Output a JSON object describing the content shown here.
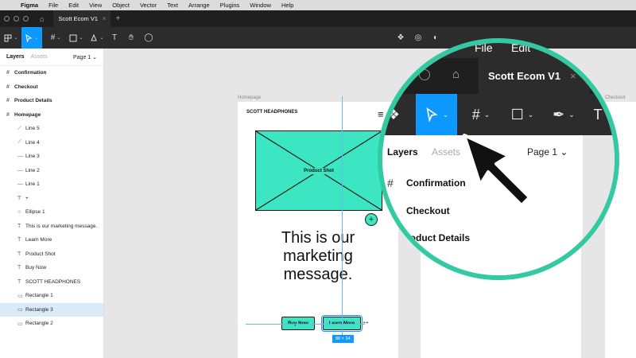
{
  "menubar": {
    "items": [
      "Figma",
      "File",
      "Edit",
      "View",
      "Object",
      "Vector",
      "Text",
      "Arrange",
      "Plugins",
      "Window",
      "Help"
    ]
  },
  "tabbar": {
    "file_tab": "Scott Ecom V1",
    "close_glyph": "×",
    "new_tab_glyph": "+"
  },
  "toolbar": {
    "tools": [
      "main-menu-icon",
      "move-tool-icon",
      "frame-tool-icon",
      "shape-tool-icon",
      "pen-tool-icon",
      "text-tool-icon",
      "hand-tool-icon",
      "comment-tool-icon"
    ],
    "active_tool": "move-tool-icon",
    "center_tools": [
      "component-icon",
      "mask-icon",
      "contrast-icon"
    ],
    "accent_color": "#0d99ff"
  },
  "left_panel": {
    "tab_layers": "Layers",
    "tab_assets": "Assets",
    "page_selector": "Page 1",
    "layers": [
      {
        "label": "Confirmation",
        "icon": "frame-icon",
        "type": "frame"
      },
      {
        "label": "Checkout",
        "icon": "frame-icon",
        "type": "frame"
      },
      {
        "label": "Product Details",
        "icon": "frame-icon",
        "type": "frame"
      },
      {
        "label": "Homepage",
        "icon": "frame-icon",
        "type": "frame"
      },
      {
        "label": "Line 5",
        "icon": "line-icon",
        "type": "child"
      },
      {
        "label": "Line 4",
        "icon": "line-icon",
        "type": "child"
      },
      {
        "label": "Line 3",
        "icon": "line-icon",
        "type": "child"
      },
      {
        "label": "Line 2",
        "icon": "line-icon",
        "type": "child"
      },
      {
        "label": "Line 1",
        "icon": "line-icon",
        "type": "child"
      },
      {
        "label": "+",
        "icon": "text-icon",
        "type": "child"
      },
      {
        "label": "Ellipse 1",
        "icon": "ellipse-icon",
        "type": "child"
      },
      {
        "label": "This is our marketing message.",
        "icon": "text-icon",
        "type": "child"
      },
      {
        "label": "Learn More",
        "icon": "text-icon",
        "type": "child"
      },
      {
        "label": "Product Shot",
        "icon": "text-icon",
        "type": "child"
      },
      {
        "label": "Buy Now",
        "icon": "text-icon",
        "type": "child"
      },
      {
        "label": "SCOTT HEADPHONES",
        "icon": "text-icon",
        "type": "child"
      },
      {
        "label": "Rectangle 1",
        "icon": "rectangle-icon",
        "type": "child"
      },
      {
        "label": "Rectangle 3",
        "icon": "rectangle-icon",
        "type": "child",
        "selected": true
      },
      {
        "label": "Rectangle 2",
        "icon": "rectangle-icon",
        "type": "child"
      }
    ]
  },
  "canvas": {
    "frame_homepage_label": "Homepage",
    "frame_checkout_label": "Checkout",
    "homepage": {
      "brand": "SCOTT HEADPHONES",
      "placeholder_label": "Product Shot",
      "marketing_message": "This is our marketing message.",
      "buy_now": "Buy Now",
      "learn_more": "Learn More",
      "plus_glyph": "+"
    },
    "selection_size": "88 × 34",
    "accent_color": "#3de6c3"
  },
  "magnifier": {
    "ring_color": "#33c9a2",
    "menu_partial": "ma",
    "menu_file": "File",
    "menu_edit": "Edit",
    "file_tab": "Scott Ecom V1",
    "close_glyph": "×",
    "tab_layers": "Layers",
    "tab_assets": "Assets",
    "page_selector": "Page 1",
    "rows": [
      "Confirmation",
      "Checkout",
      "roduct Details"
    ]
  }
}
